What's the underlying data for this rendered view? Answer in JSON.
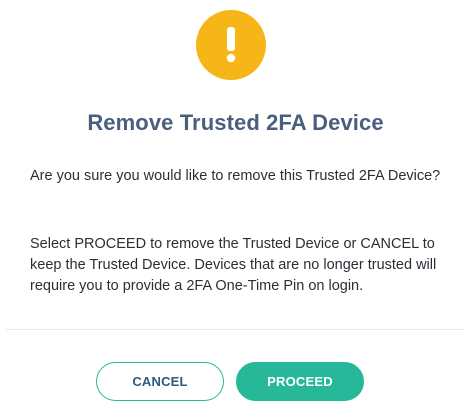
{
  "dialog": {
    "icon": "warning-exclamation-icon",
    "icon_color": "#f7b617",
    "title": "Remove Trusted 2FA Device",
    "paragraph1": "Are you sure you would like to remove this Trusted 2FA Device?",
    "paragraph2": "Select PROCEED to remove the Trusted Device or CANCEL to keep the Trusted Device. Devices that are no longer trusted will require you to provide a 2FA One-Time Pin on login.",
    "cancel_label": "CANCEL",
    "proceed_label": "PROCEED",
    "accent_color": "#27b89a",
    "title_color": "#4a5f7e"
  }
}
